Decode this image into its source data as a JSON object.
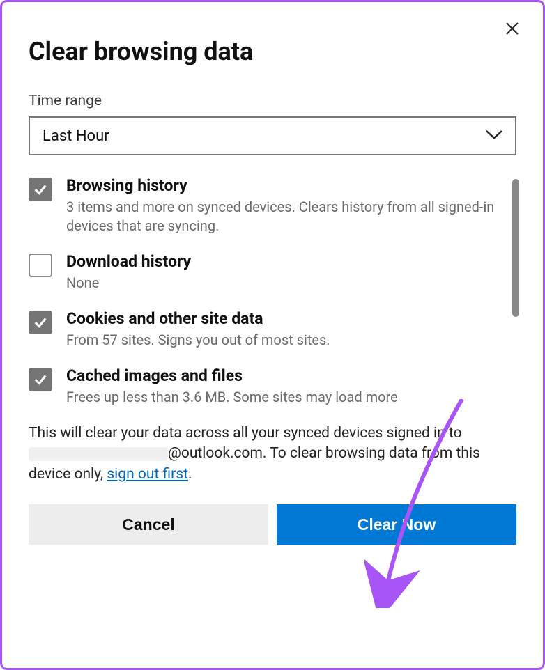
{
  "dialog": {
    "title": "Clear browsing data",
    "time_range_label": "Time range",
    "time_range_value": "Last Hour"
  },
  "options": [
    {
      "title": "Browsing history",
      "desc": "3 items and more on synced devices. Clears history from all signed-in devices that are syncing.",
      "checked": true
    },
    {
      "title": "Download history",
      "desc": "None",
      "checked": false
    },
    {
      "title": "Cookies and other site data",
      "desc": "From 57 sites. Signs you out of most sites.",
      "checked": true
    },
    {
      "title": "Cached images and files",
      "desc": "Frees up less than 3.6 MB. Some sites may load more",
      "checked": true
    }
  ],
  "footer": {
    "text_before": "This will clear your data across all your synced devices signed in to ",
    "email_suffix": "@outlook.com",
    "text_middle": ". To clear browsing data from this device only, ",
    "link": "sign out first",
    "text_after": "."
  },
  "buttons": {
    "cancel": "Cancel",
    "clear": "Clear Now"
  },
  "annotation": {
    "arrow_color": "#a855f7"
  }
}
